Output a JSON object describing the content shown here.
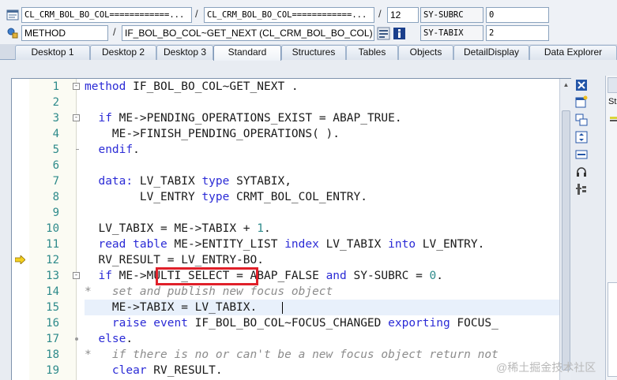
{
  "header": {
    "row1": {
      "class_field": "CL_CRM_BOL_BO_COL============...",
      "class_field2": "CL_CRM_BOL_BO_COL============...",
      "line_no": "12",
      "var_name": "SY-SUBRC",
      "var_value": "0"
    },
    "row2": {
      "type_field": "METHOD",
      "method_field": "IF_BOL_BO_COL~GET_NEXT (CL_CRM_BOL_BO_COL)",
      "var_name": "SY-TABIX",
      "var_value": "2"
    },
    "separator": "/"
  },
  "tabs": [
    {
      "label": "Desktop 1",
      "active": false
    },
    {
      "label": "Desktop 2",
      "active": false
    },
    {
      "label": "Desktop 3",
      "active": false
    },
    {
      "label": "Standard",
      "active": true
    },
    {
      "label": "Structures",
      "active": false
    },
    {
      "label": "Tables",
      "active": false
    },
    {
      "label": "Objects",
      "active": false
    },
    {
      "label": "DetailDisplay",
      "active": false
    },
    {
      "label": "Data Explorer",
      "active": false
    }
  ],
  "code": {
    "current_line": 12,
    "lines": [
      {
        "n": "1",
        "fold": "box-minus",
        "segments": [
          {
            "t": "method",
            "c": "kw"
          },
          {
            "t": " IF_BOL_BO_COL~GET_NEXT .",
            "c": ""
          }
        ]
      },
      {
        "n": "2",
        "fold": "line",
        "segments": []
      },
      {
        "n": "3",
        "fold": "box-minus",
        "segments": [
          {
            "t": "  ",
            "c": ""
          },
          {
            "t": "if",
            "c": "kw"
          },
          {
            "t": " ME->PENDING_OPERATIONS_EXIST = ABAP_TRUE.",
            "c": ""
          }
        ]
      },
      {
        "n": "4",
        "fold": "line",
        "segments": [
          {
            "t": "    ME->FINISH_PENDING_OPERATIONS( ).",
            "c": ""
          }
        ]
      },
      {
        "n": "5",
        "fold": "tick",
        "segments": [
          {
            "t": "  ",
            "c": ""
          },
          {
            "t": "endif",
            "c": "kw"
          },
          {
            "t": ".",
            "c": ""
          }
        ]
      },
      {
        "n": "6",
        "fold": "line",
        "segments": []
      },
      {
        "n": "7",
        "fold": "line",
        "segments": [
          {
            "t": "  ",
            "c": ""
          },
          {
            "t": "data:",
            "c": "kw"
          },
          {
            "t": " LV_TABIX ",
            "c": ""
          },
          {
            "t": "type",
            "c": "kw"
          },
          {
            "t": " SYTABIX,",
            "c": ""
          }
        ]
      },
      {
        "n": "8",
        "fold": "line",
        "segments": [
          {
            "t": "        LV_ENTRY ",
            "c": ""
          },
          {
            "t": "type",
            "c": "kw"
          },
          {
            "t": " CRMT_BOL_COL_ENTRY.",
            "c": ""
          }
        ]
      },
      {
        "n": "9",
        "fold": "line",
        "segments": []
      },
      {
        "n": "10",
        "fold": "line",
        "segments": [
          {
            "t": "  LV_TABIX = ME->TABIX + ",
            "c": ""
          },
          {
            "t": "1",
            "c": "num"
          },
          {
            "t": ".",
            "c": ""
          }
        ]
      },
      {
        "n": "11",
        "fold": "line",
        "segments": [
          {
            "t": "  ",
            "c": ""
          },
          {
            "t": "read table",
            "c": "kw"
          },
          {
            "t": " ME->ENTITY_LIST ",
            "c": ""
          },
          {
            "t": "index",
            "c": "kw"
          },
          {
            "t": " LV_TABIX ",
            "c": ""
          },
          {
            "t": "into",
            "c": "kw"
          },
          {
            "t": " LV_ENTRY.",
            "c": ""
          }
        ]
      },
      {
        "n": "12",
        "fold": "line",
        "segments": [
          {
            "t": "  RV_RESULT = LV_ENTRY-BO.",
            "c": ""
          }
        ]
      },
      {
        "n": "13",
        "fold": "box-minus",
        "segments": [
          {
            "t": "  ",
            "c": ""
          },
          {
            "t": "if",
            "c": "kw"
          },
          {
            "t": " ME->MULTI_SELECT = ABAP_FALSE ",
            "c": ""
          },
          {
            "t": "and",
            "c": "kw"
          },
          {
            "t": " SY-SUBRC = ",
            "c": ""
          },
          {
            "t": "0",
            "c": "num"
          },
          {
            "t": ".",
            "c": ""
          }
        ]
      },
      {
        "n": "14",
        "fold": "line",
        "segments": [
          {
            "t": "*   set and publish new focus object",
            "c": "cm"
          }
        ]
      },
      {
        "n": "15",
        "fold": "line",
        "segments": [
          {
            "t": "    ME->TABIX = LV_TABIX.",
            "c": ""
          }
        ]
      },
      {
        "n": "16",
        "fold": "line",
        "segments": [
          {
            "t": "    ",
            "c": ""
          },
          {
            "t": "raise event",
            "c": "kw"
          },
          {
            "t": " IF_BOL_BO_COL~FOCUS_CHANGED ",
            "c": ""
          },
          {
            "t": "exporting",
            "c": "kw"
          },
          {
            "t": " FOCUS_",
            "c": ""
          }
        ]
      },
      {
        "n": "17",
        "fold": "dot",
        "segments": [
          {
            "t": "  ",
            "c": ""
          },
          {
            "t": "else",
            "c": "kw"
          },
          {
            "t": ".",
            "c": ""
          }
        ]
      },
      {
        "n": "18",
        "fold": "line",
        "segments": [
          {
            "t": "*   if there is no or can't be a new focus object return not",
            "c": "cm"
          }
        ]
      },
      {
        "n": "19",
        "fold": "line",
        "segments": [
          {
            "t": "    ",
            "c": ""
          },
          {
            "t": "clear",
            "c": "kw"
          },
          {
            "t": " RV_RESULT.",
            "c": ""
          }
        ]
      }
    ]
  },
  "right_panel": {
    "text": "Str"
  },
  "watermark": "@稀土掘金技术社区",
  "colors": {
    "keyword": "#2b2bd6",
    "number": "#2d8a8a",
    "comment": "#8c8c8c",
    "highlight_box": "#e0202a"
  }
}
